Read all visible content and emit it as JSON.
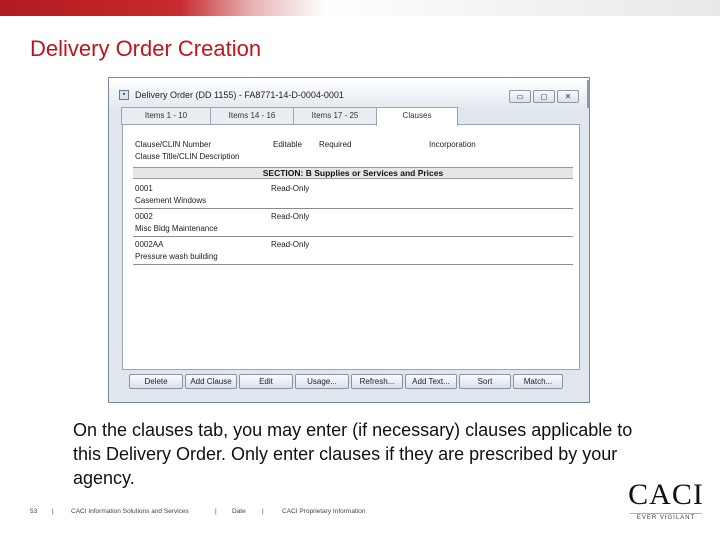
{
  "slide": {
    "title": "Delivery Order Creation",
    "caption": "On the clauses tab, you may enter (if necessary) clauses applicable to this Delivery Order.  Only enter clauses if they are prescribed by your agency."
  },
  "window": {
    "title": "Delivery Order (DD 1155) - FA8771-14-D-0004-0001",
    "controls": {
      "minimize": "▭",
      "maximize": "◻",
      "close": "✕"
    },
    "tabs": [
      "Items 1 - 10",
      "Items 14 - 16",
      "Items 17 - 25",
      "Clauses"
    ],
    "active_tab": "Clauses"
  },
  "clauses": {
    "headers": {
      "clause_clin_number": "Clause/CLIN Number",
      "editable": "Editable",
      "required": "Required",
      "incorporation": "Incorporation",
      "clause_title": "Clause Title/CLIN Description"
    },
    "section": "SECTION: B    Supplies or Services and Prices",
    "rows": [
      {
        "number": "0001",
        "editable": "Read-Only",
        "description": "Casement Windows"
      },
      {
        "number": "0002",
        "editable": "Read-Only",
        "description": "Misc Bldg Maintenance"
      },
      {
        "number": "0002AA",
        "editable": "Read-Only",
        "description": "Pressure wash building"
      }
    ]
  },
  "buttons": [
    "Delete",
    "Add Clause",
    "Edit",
    "Usage...",
    "Refresh...",
    "Add Text...",
    "Sort",
    "Match..."
  ],
  "footer": {
    "page": "53",
    "sep": "|",
    "company": "CACI Information Solutions and Services",
    "date": "Date",
    "proprietary": "CACI Proprietary Information"
  },
  "logo": {
    "word": "CACI",
    "tagline": "EVER VIGILANT"
  },
  "colors": {
    "title_red": "#c0141c",
    "bar_red": "#b11a1f"
  }
}
